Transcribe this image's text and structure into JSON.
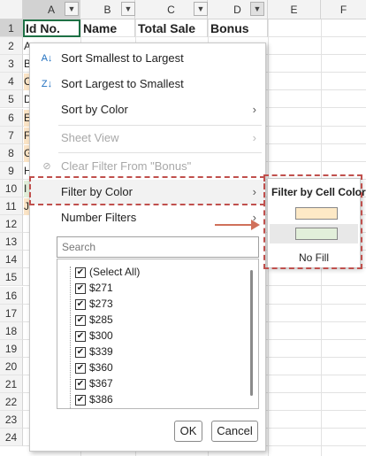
{
  "columns": [
    "A",
    "B",
    "C",
    "D",
    "E",
    "F"
  ],
  "rows": [
    "1",
    "2",
    "3",
    "4",
    "5",
    "6",
    "7",
    "8",
    "9",
    "10",
    "11",
    "12",
    "13",
    "14",
    "15",
    "16",
    "17",
    "18",
    "19",
    "20",
    "21",
    "22",
    "23",
    "24"
  ],
  "header_cells": {
    "a": "Id No.",
    "b": "Name",
    "c": "Total Sale",
    "d": "Bonus"
  },
  "left_chars": [
    "A",
    "B",
    "C",
    "D",
    "E",
    "F",
    "G",
    "H",
    "I",
    "J"
  ],
  "row_colors": {
    "orange": "#fbe4c6",
    "green": "#e2efda"
  },
  "menu": {
    "sort_asc": "Sort Smallest to Largest",
    "sort_desc": "Sort Largest to Smallest",
    "sort_color": "Sort by Color",
    "sheet_view": "Sheet View",
    "clear_filter": "Clear Filter From \"Bonus\"",
    "filter_color": "Filter by Color",
    "number_filters": "Number Filters",
    "search_placeholder": "Search",
    "ok": "OK",
    "cancel": "Cancel"
  },
  "checklist": [
    "(Select All)",
    "$271",
    "$273",
    "$285",
    "$300",
    "$339",
    "$360",
    "$367",
    "$386"
  ],
  "submenu": {
    "title": "Filter by Cell Color",
    "swatch_colors": [
      "#fde9c6",
      "#e2efda"
    ],
    "no_fill": "No Fill"
  },
  "accent": "#c0504d"
}
